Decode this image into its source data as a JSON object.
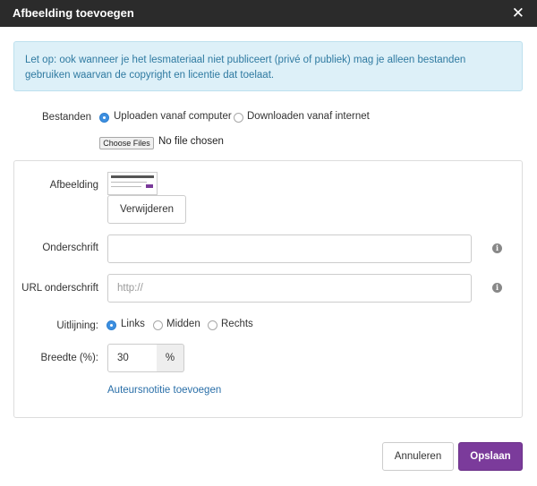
{
  "dialog": {
    "title": "Afbeelding toevoegen",
    "close_glyph": "✕"
  },
  "alert": {
    "text": "Let op: ook wanneer je het lesmateriaal niet publiceert (privé of publiek) mag je alleen bestanden gebruiken waarvan de copyright en licentie dat toelaat."
  },
  "source": {
    "label": "Bestanden",
    "options": [
      {
        "label": "Uploaden vanaf computer",
        "checked": true
      },
      {
        "label": "Downloaden vanaf internet",
        "checked": false
      }
    ],
    "file_button": "Choose Files",
    "file_status": "No file chosen"
  },
  "image": {
    "label": "Afbeelding",
    "remove_button": "Verwijderen"
  },
  "caption": {
    "label": "Onderschrift",
    "value": "",
    "info_glyph": "i"
  },
  "caption_url": {
    "label": "URL onderschrift",
    "placeholder": "http://",
    "info_glyph": "i"
  },
  "alignment": {
    "label": "Uitlijning:",
    "options": [
      {
        "label": "Links",
        "checked": true
      },
      {
        "label": "Midden",
        "checked": false
      },
      {
        "label": "Rechts",
        "checked": false
      }
    ]
  },
  "width": {
    "label": "Breedte (%):",
    "value": "30",
    "unit": "%"
  },
  "author_note_link": "Auteursnotitie toevoegen",
  "footer": {
    "cancel": "Annuleren",
    "save": "Opslaan"
  },
  "colors": {
    "accent": "#7b3b9b",
    "header": "#2b2b2b",
    "alert_bg": "#ddf0f8",
    "link": "#2a6fa8",
    "radio_checked": "#3d8fe0"
  },
  "icons": [
    "close-icon",
    "info-icon"
  ]
}
